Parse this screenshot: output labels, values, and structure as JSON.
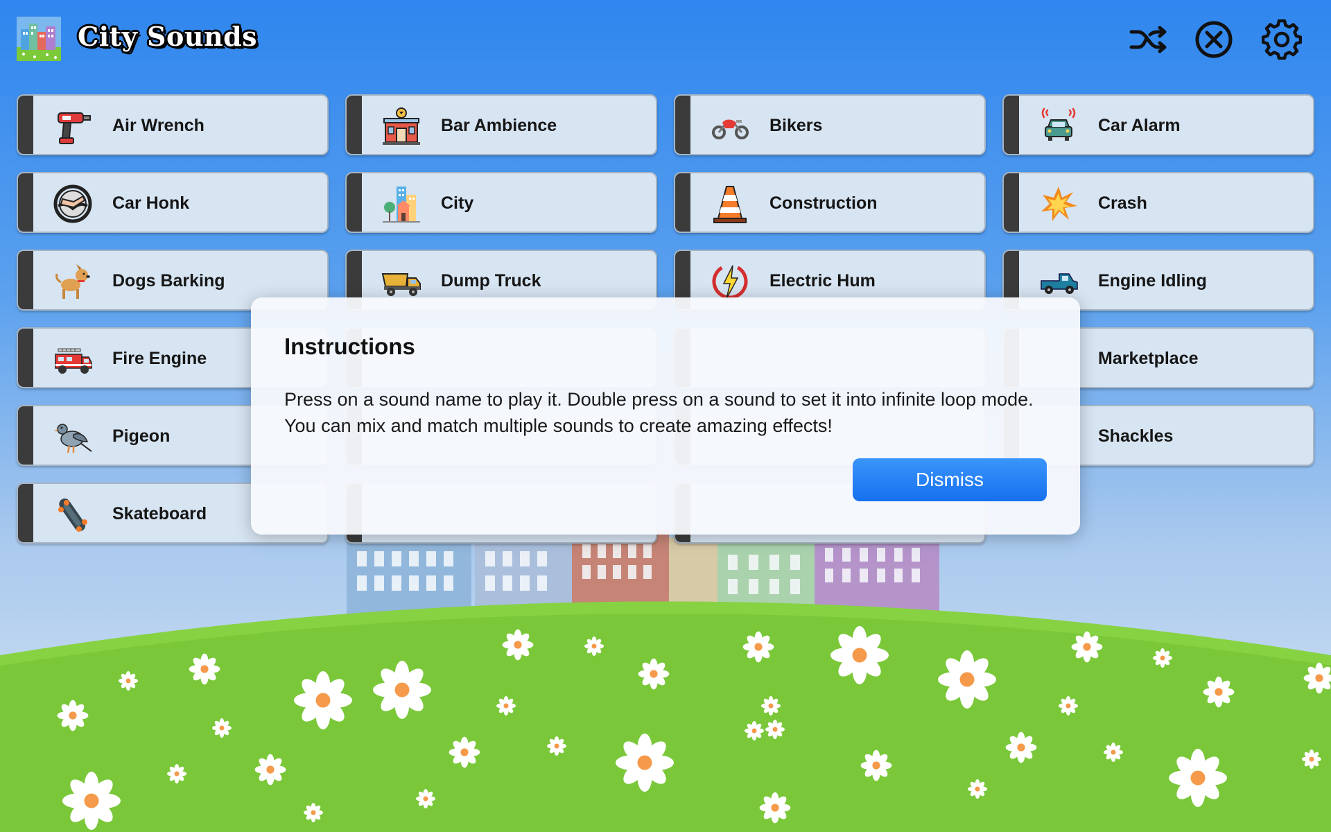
{
  "app": {
    "title": "City Sounds",
    "logo_icon": "city-logo-icon"
  },
  "header": {
    "shuffle_icon": "shuffle-icon",
    "stop_icon": "close-circle-icon",
    "settings_icon": "gear-icon"
  },
  "sounds": [
    {
      "label": "Air Wrench",
      "icon": "drill-icon"
    },
    {
      "label": "Bar Ambience",
      "icon": "bar-building-icon"
    },
    {
      "label": "Bikers",
      "icon": "motorcycle-icon"
    },
    {
      "label": "Car Alarm",
      "icon": "car-alarm-icon"
    },
    {
      "label": "Car Honk",
      "icon": "steering-wheel-icon"
    },
    {
      "label": "City",
      "icon": "city-buildings-icon"
    },
    {
      "label": "Construction",
      "icon": "traffic-cone-icon"
    },
    {
      "label": "Crash",
      "icon": "explosion-icon"
    },
    {
      "label": "Dogs Barking",
      "icon": "dog-icon"
    },
    {
      "label": "Dump Truck",
      "icon": "dump-truck-icon"
    },
    {
      "label": "Electric Hum",
      "icon": "lightning-icon"
    },
    {
      "label": "Engine Idling",
      "icon": "pickup-truck-icon"
    },
    {
      "label": "Fire Engine",
      "icon": "fire-truck-icon"
    },
    {
      "label": "",
      "icon": ""
    },
    {
      "label": "",
      "icon": ""
    },
    {
      "label": "Marketplace",
      "icon": ""
    },
    {
      "label": "Pigeon",
      "icon": "pigeon-icon"
    },
    {
      "label": "",
      "icon": ""
    },
    {
      "label": "",
      "icon": ""
    },
    {
      "label": "Shackles",
      "icon": ""
    },
    {
      "label": "Skateboard",
      "icon": "skateboard-icon"
    },
    {
      "label": "",
      "icon": ""
    },
    {
      "label": "",
      "icon": ""
    }
  ],
  "modal": {
    "title": "Instructions",
    "body": "Press on a sound name to play it. Double press on a sound to set it into infinite loop mode. You can mix and match multiple sounds to create amazing effects!",
    "dismiss_label": "Dismiss"
  },
  "colors": {
    "sky_top": "#2f86ee",
    "grass": "#7cc93a",
    "button_bg": "#d7e4f2",
    "button_stripe": "#3b3b3b",
    "accent": "#1f7ff3"
  }
}
